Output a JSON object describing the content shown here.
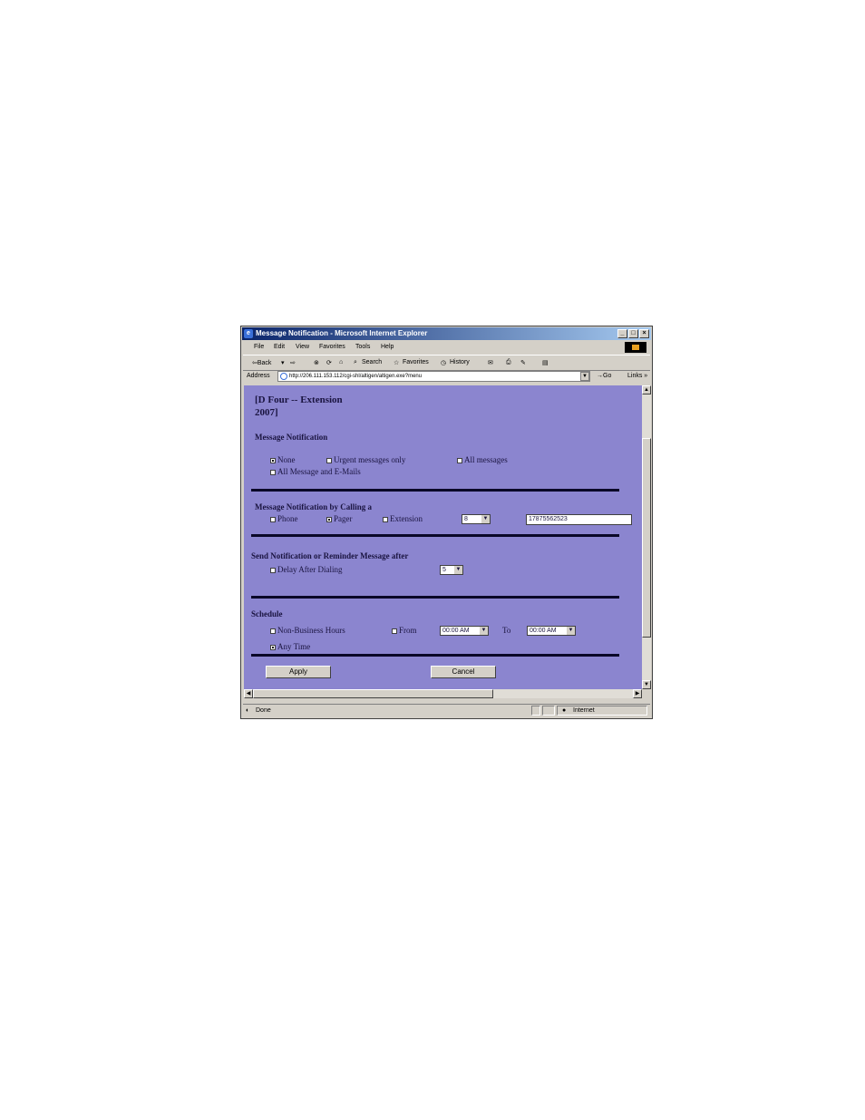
{
  "window": {
    "title": "Message Notification - Microsoft Internet Explorer",
    "min_label": "_",
    "max_label": "□",
    "close_label": "×"
  },
  "menu": [
    "File",
    "Edit",
    "View",
    "Favorites",
    "Tools",
    "Help"
  ],
  "toolbar": {
    "back": "⇦Back",
    "search": "Search",
    "favorites": "Favorites",
    "history": "History"
  },
  "address": {
    "label": "Address",
    "url": "http://206.111.153.112/cgi-shl/altigen/altigen.exe?menu",
    "go": "Go",
    "links": "Links »"
  },
  "page": {
    "heading_line1": "[D Four -- Extension",
    "heading_line2": "2007]",
    "section1": {
      "title": "Message Notification",
      "opt_none": "None",
      "opt_urgent": "Urgent messages only",
      "opt_all": "All messages",
      "opt_all_email": "All Message and E-Mails"
    },
    "section2": {
      "title": "Message Notification by Calling a",
      "opt_phone": "Phone",
      "opt_pager": "Pager",
      "opt_extension": "Extension",
      "select_value": "8",
      "number_value": "17875562523"
    },
    "section3": {
      "title": "Send Notification or Reminder Message after",
      "opt_delay": "Delay After Dialing",
      "select_value": "5"
    },
    "section4": {
      "title": "Schedule",
      "opt_nonbiz": "Non-Business Hours",
      "opt_from": "From",
      "from_value": "00:00 AM",
      "to_label": "To",
      "to_value": "00:00 AM",
      "opt_anytime": "Any Time"
    },
    "apply": "Apply",
    "cancel": "Cancel"
  },
  "status": {
    "text": "Done",
    "zone": "Internet"
  }
}
